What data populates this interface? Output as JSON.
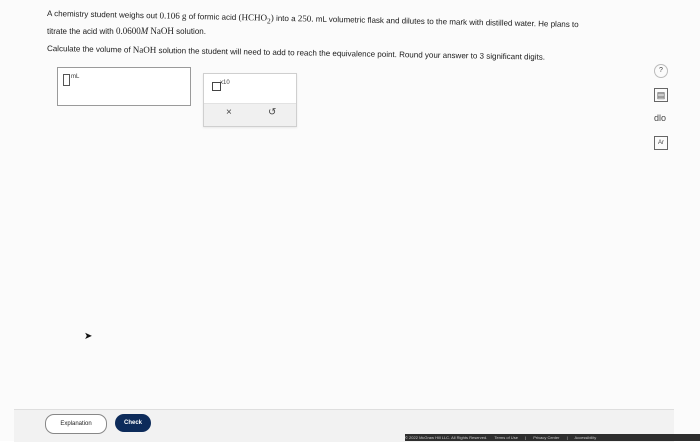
{
  "question": {
    "line1": {
      "p1": "A chemistry student weighs out",
      "mass": "0.106",
      "unit": "g",
      "p2": "of formic acid",
      "formula": "(HCHO",
      "formula_sub": "2",
      "formula_close": ")",
      "p3": "into a",
      "vol": "250.",
      "p4": "mL volumetric flask and dilutes to the mark with distilled water. He plans to"
    },
    "line2": {
      "p1": "titrate the acid with",
      "conc": "0.0600",
      "m": "M",
      "base": "NaOH",
      "p2": "solution."
    },
    "line3": {
      "p1": "Calculate the volume of",
      "base": "NaOH",
      "p2": "solution the student will need to add to reach the equivalence point. Round your answer to 3 significant digits."
    }
  },
  "answer": {
    "unit": "mL"
  },
  "keypad": {
    "sci_label": "x10",
    "clear": "×",
    "undo": "↺"
  },
  "sidebar": {
    "help": "?",
    "calculator": "▤",
    "chart": "dlo",
    "periodic": "Ar"
  },
  "footer": {
    "explanation": "Explanation",
    "check": "Check",
    "legal": [
      "© 2022 McGraw Hill LLC. All Rights Reserved.",
      "Terms of Use",
      "|",
      "Privacy Center",
      "|",
      "Accessibility"
    ]
  }
}
